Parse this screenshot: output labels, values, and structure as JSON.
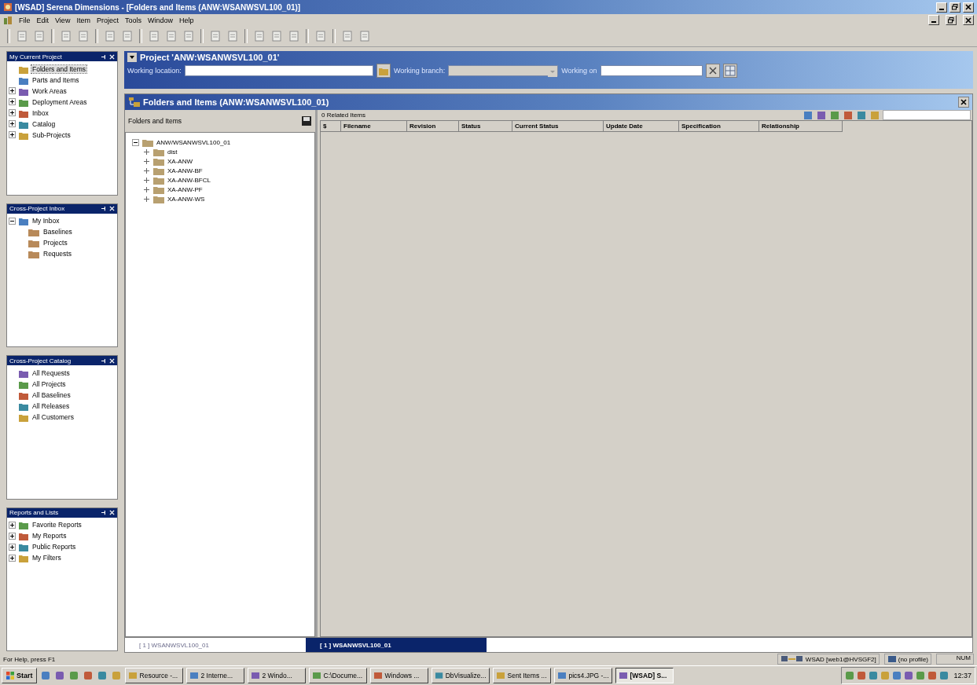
{
  "window": {
    "title": "[WSAD] Serena Dimensions - [Folders and Items (ANW:WSANWSVL100_01)]"
  },
  "menu": [
    "File",
    "Edit",
    "View",
    "Item",
    "Project",
    "Tools",
    "Window",
    "Help"
  ],
  "side_panels": [
    {
      "title": "My Current Project",
      "items": [
        {
          "label": "Folders and Items",
          "selected": true
        },
        {
          "label": "Parts and Items",
          "selected": false
        },
        {
          "label": "Work Areas",
          "selected": false,
          "expanded": false
        },
        {
          "label": "Deployment Areas",
          "selected": false,
          "expanded": false
        },
        {
          "label": "Inbox",
          "selected": false,
          "expanded": false
        },
        {
          "label": "Catalog",
          "selected": false,
          "expanded": false
        },
        {
          "label": "Sub-Projects",
          "selected": false,
          "expanded": false
        }
      ]
    },
    {
      "title": "Cross-Project Inbox",
      "items": [
        {
          "label": "My Inbox",
          "selected": false,
          "expanded": true,
          "children": [
            {
              "label": "Baselines",
              "selected": false
            },
            {
              "label": "Projects",
              "selected": false
            },
            {
              "label": "Requests",
              "selected": false
            }
          ]
        }
      ]
    },
    {
      "title": "Cross-Project Catalog",
      "items": [
        {
          "label": "All Requests",
          "selected": false
        },
        {
          "label": "All Projects",
          "selected": false
        },
        {
          "label": "All Baselines",
          "selected": false
        },
        {
          "label": "All Releases",
          "selected": false
        },
        {
          "label": "All Customers",
          "selected": false
        }
      ]
    },
    {
      "title": "Reports and Lists",
      "items": [
        {
          "label": "Favorite Reports",
          "selected": false,
          "expanded": false
        },
        {
          "label": "My Reports",
          "selected": false,
          "expanded": false
        },
        {
          "label": "Public Reports",
          "selected": false,
          "expanded": false
        },
        {
          "label": "My Filters",
          "selected": false,
          "expanded": false
        }
      ]
    }
  ],
  "project": {
    "title": "Project 'ANW:WSANWSVL100_01'",
    "working_location": {
      "label": "Working location:"
    },
    "working_branch": {
      "label": "Working branch:",
      "disabled": true
    },
    "working_on": {
      "label": "Working on"
    }
  },
  "folders_panel": {
    "title": "Folders and Items (ANW:WSANWSVL100_01)",
    "tree_header": "Folders and Items",
    "tree": {
      "label": "ANW/WSANWSVL100_01",
      "expanded": true,
      "children": [
        {
          "label": "dist",
          "expanded": false
        },
        {
          "label": "XA-ANW",
          "expanded": false
        },
        {
          "label": "XA-ANW-BF",
          "expanded": false
        },
        {
          "label": "XA-ANW-BFCL",
          "expanded": false
        },
        {
          "label": "XA-ANW-PF",
          "expanded": false
        },
        {
          "label": "XA-ANW-WS",
          "expanded": false
        }
      ]
    },
    "related_count": "0 Related Items",
    "columns": [
      "$",
      "Filename",
      "Revision",
      "Status",
      "Current Status",
      "Update Date",
      "Specification",
      "Relationship"
    ]
  },
  "doc_tabs": [
    {
      "label": "[ 1 ] WSANWSVL100_01",
      "selected": false
    },
    {
      "label": "[ 1 ] WSANWSVL100_01",
      "selected": true
    }
  ],
  "status_bar": {
    "help": "For Help, press F1",
    "connection": "WSAD [web1@HVSGF2]",
    "profile": "(no profile)",
    "num": "NUM"
  },
  "taskbar": {
    "start": "Start",
    "buttons": [
      {
        "label": "Resource -...",
        "selected": false
      },
      {
        "label": "2 Interne...",
        "selected": false
      },
      {
        "label": "2 Windo...",
        "selected": false
      },
      {
        "label": "C:\\Docume...",
        "selected": false
      },
      {
        "label": "Windows ...",
        "selected": false
      },
      {
        "label": "DbVisualize...",
        "selected": false
      },
      {
        "label": "Sent Items ...",
        "selected": false
      },
      {
        "label": "pics4.JPG -...",
        "selected": false
      },
      {
        "label": "[WSAD] S...",
        "selected": true
      }
    ],
    "clock": "12:37"
  }
}
